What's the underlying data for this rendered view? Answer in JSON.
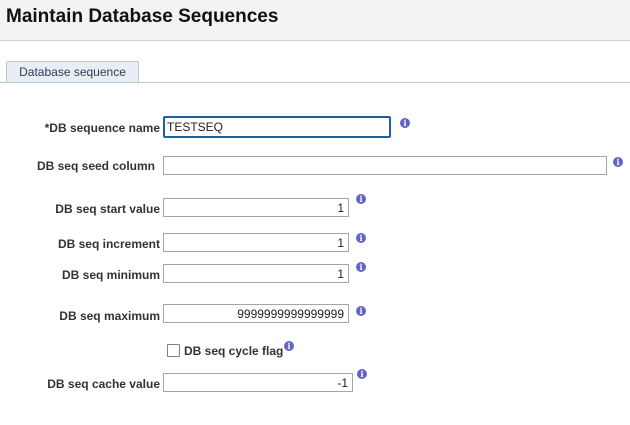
{
  "page": {
    "title": "Maintain Database Sequences"
  },
  "tabs": [
    {
      "label": "Database sequence"
    }
  ],
  "form": {
    "sequence_name": {
      "label": "*DB sequence name",
      "value": "TESTSEQ"
    },
    "seed_column": {
      "label": "DB seq seed column",
      "value": ""
    },
    "start_value": {
      "label": "DB seq start value",
      "value": "1"
    },
    "increment": {
      "label": "DB seq increment",
      "value": "1"
    },
    "minimum": {
      "label": "DB seq minimum",
      "value": "1"
    },
    "maximum": {
      "label": "DB seq maximum",
      "value": "9999999999999999"
    },
    "cycle_flag": {
      "label": "DB seq cycle flag",
      "checked": false
    },
    "cache_value": {
      "label": "DB seq cache value",
      "value": "-1"
    }
  },
  "icons": {
    "info": "info-icon",
    "info_glyph": "i"
  },
  "colors": {
    "focus_border": "#1f5fa3",
    "info_icon": "#6262c8",
    "tab_bg": "#e9eef4"
  }
}
